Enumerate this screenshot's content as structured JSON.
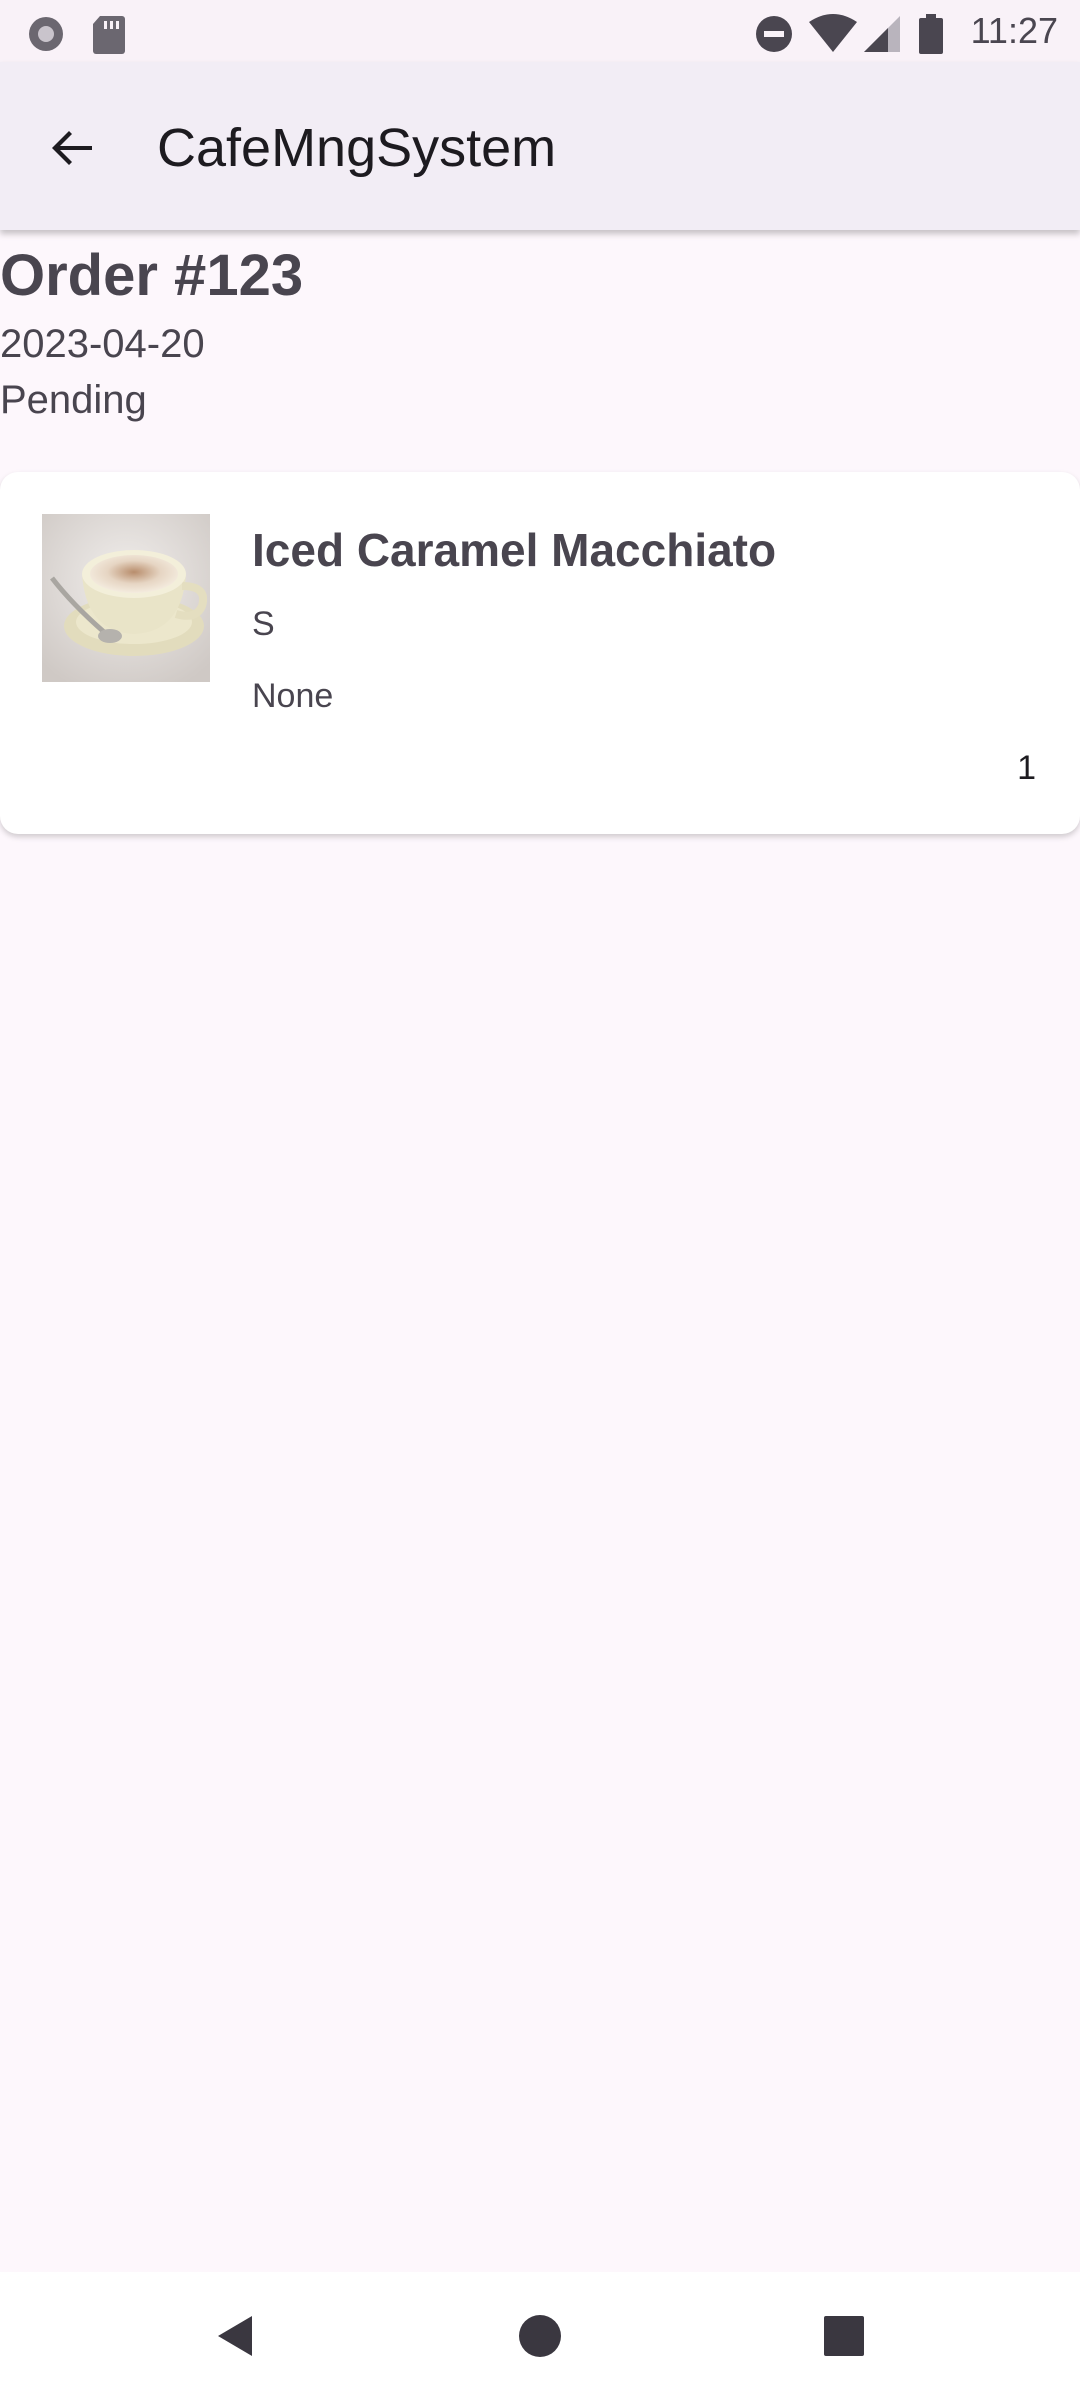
{
  "status_bar": {
    "time": "11:27",
    "left_icons": [
      "record-icon",
      "sd-card-icon"
    ],
    "right_icons": [
      "do-not-disturb-icon",
      "wifi-icon",
      "signal-icon",
      "battery-icon"
    ]
  },
  "app_bar": {
    "title": "CafeMngSystem",
    "back_icon": "arrow-back-icon"
  },
  "order": {
    "title": "Order #123",
    "date": "2023-04-20",
    "status": "Pending",
    "items": [
      {
        "name": "Iced Caramel Macchiato",
        "size": "S",
        "option": "None",
        "quantity": "1",
        "image": "coffee-cup-image"
      }
    ]
  },
  "nav_bar": {
    "buttons": [
      "back-triangle-icon",
      "home-circle-icon",
      "recents-square-icon"
    ]
  },
  "colors": {
    "background": "#fdf7fc",
    "app_bar": "#f2edf5",
    "text_primary": "#1d1b20",
    "text_secondary": "#49454f",
    "card": "#ffffff"
  }
}
